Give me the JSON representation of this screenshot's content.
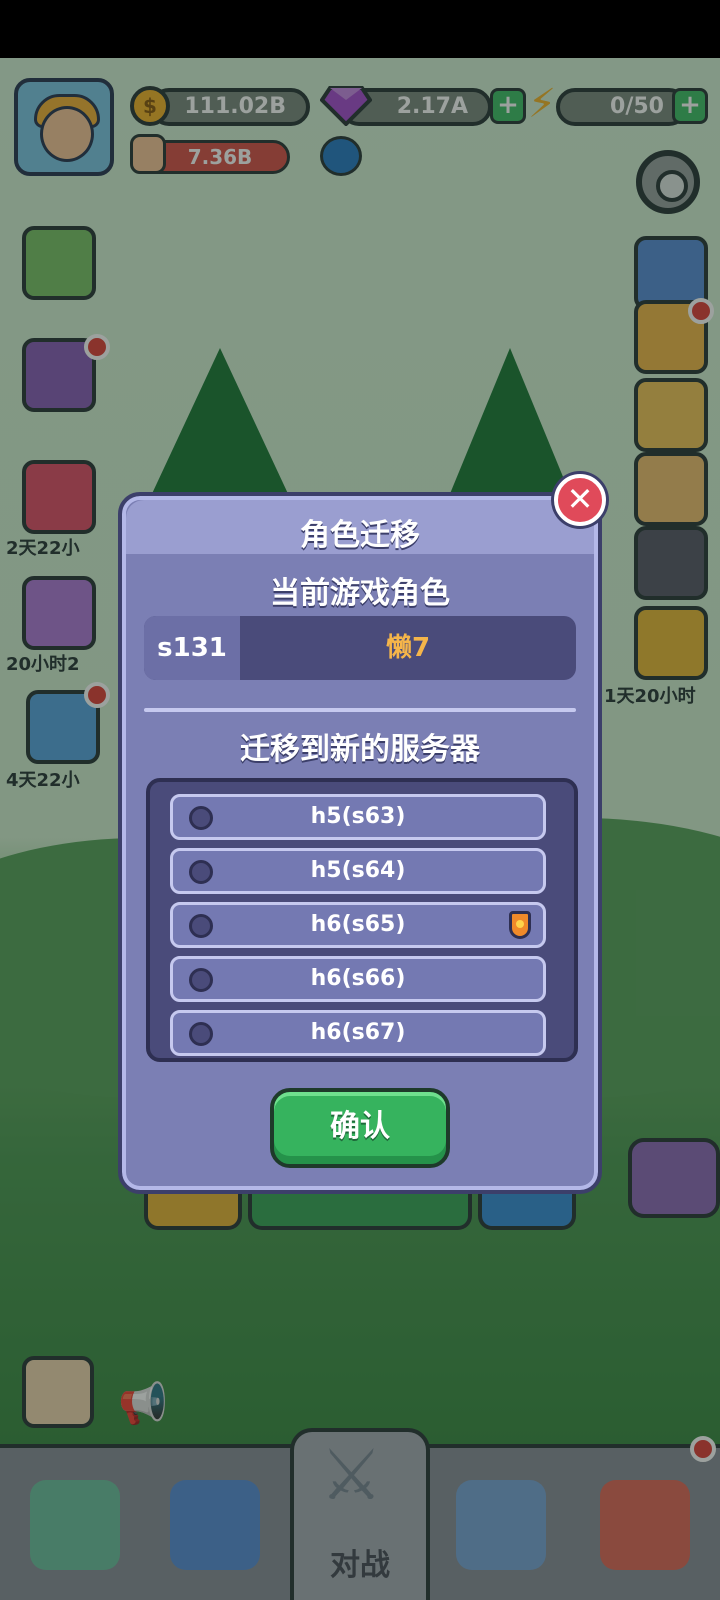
{
  "hud": {
    "gold": "111.02B",
    "gems": "2.17A",
    "energy": "0/50",
    "power": "7.36B"
  },
  "side_timers": {
    "left_1": "2天22小",
    "left_2": "20小时2",
    "left_3": "4天22小",
    "right_1": "1天20小时"
  },
  "dialog": {
    "title": "角色迁移",
    "current_section_title": "当前游戏角色",
    "current_server": "s131",
    "current_character": "懒7",
    "target_section_title": "迁移到新的服务器",
    "servers": [
      {
        "label": "h5(s63)",
        "selected": false,
        "recommended": false
      },
      {
        "label": "h5(s64)",
        "selected": false,
        "recommended": false
      },
      {
        "label": "h6(s65)",
        "selected": false,
        "recommended": true
      },
      {
        "label": "h6(s66)",
        "selected": false,
        "recommended": false
      },
      {
        "label": "h6(s67)",
        "selected": false,
        "recommended": false
      }
    ],
    "confirm_label": "确认",
    "close_icon": "close-icon"
  },
  "bottom_nav": {
    "active_tab_label": "对战"
  },
  "colors": {
    "dialog_bg": "#7b7fb4",
    "confirm_green": "#36b35e",
    "current_name_orange": "#f5b54a",
    "close_red": "#e04a5a"
  }
}
